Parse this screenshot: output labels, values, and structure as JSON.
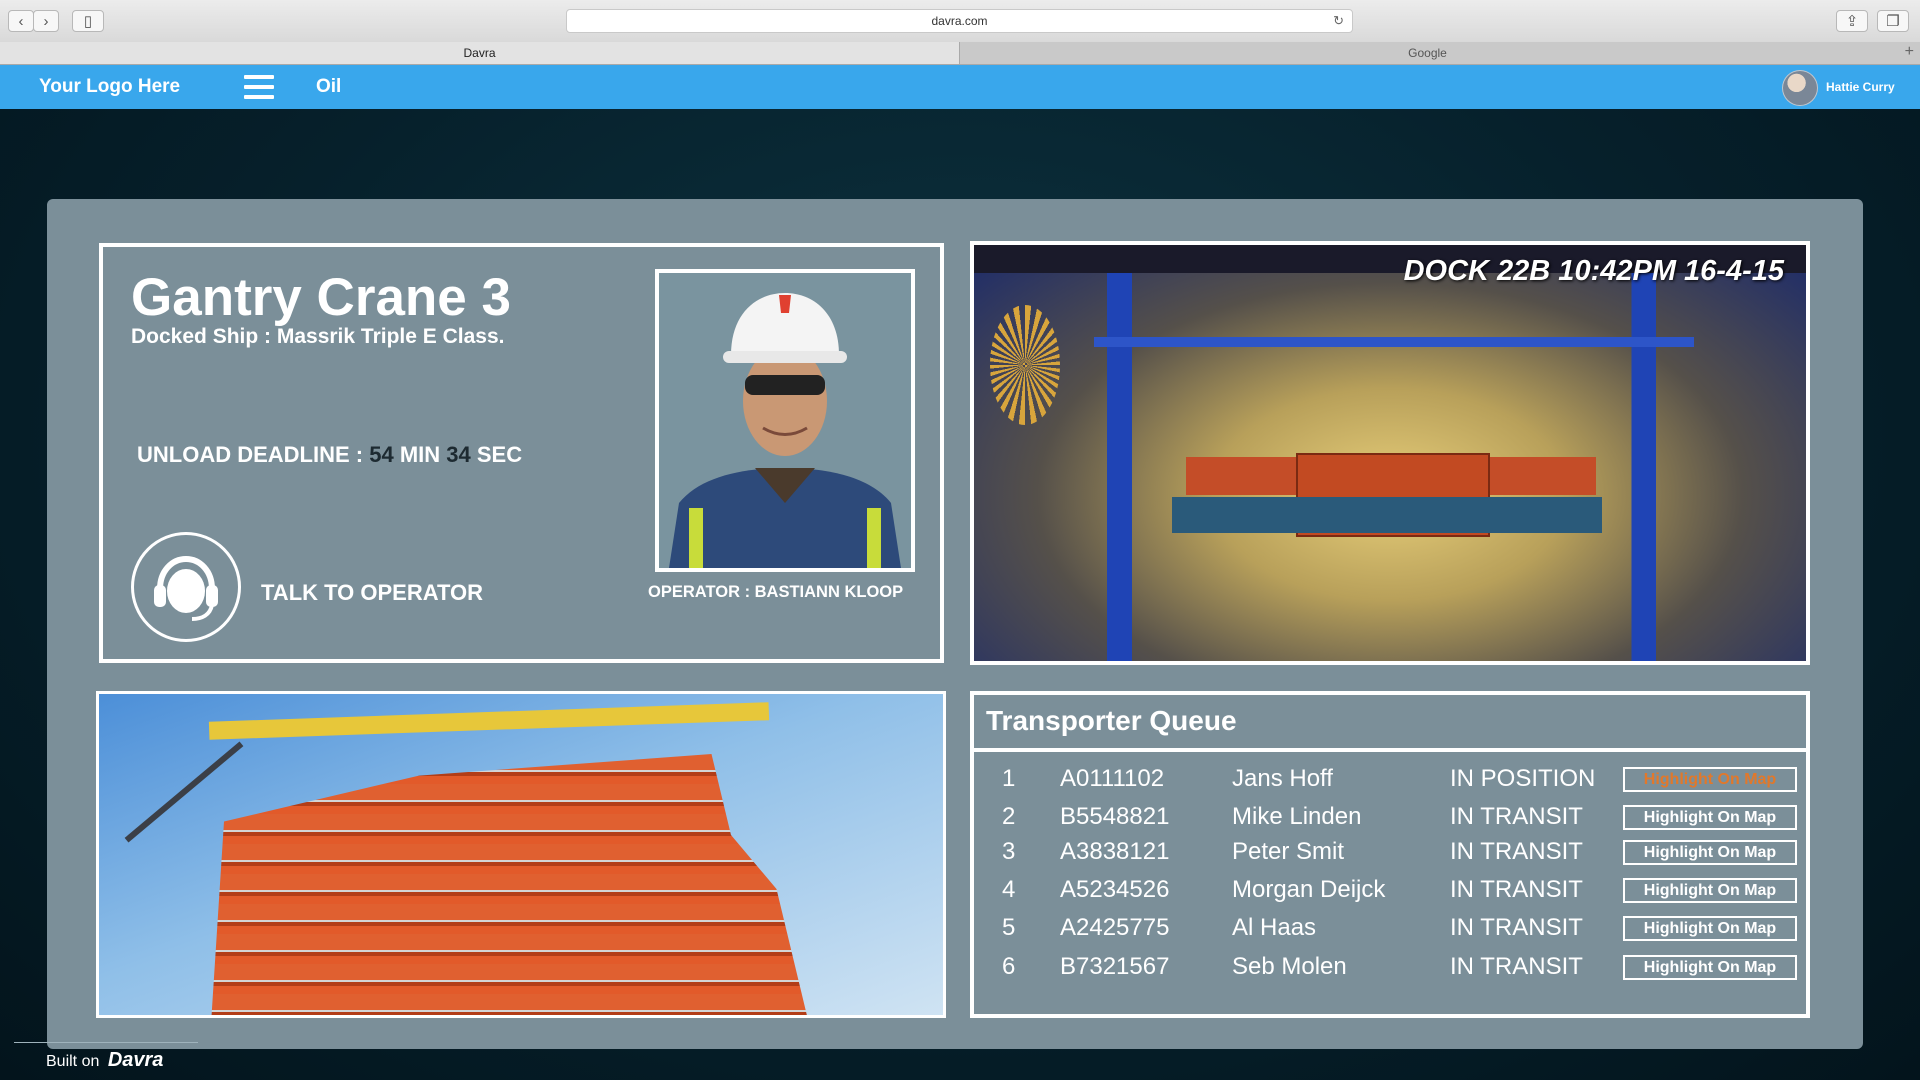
{
  "browser": {
    "address": "davra.com",
    "tabs": [
      {
        "label": "Davra",
        "active": true
      },
      {
        "label": "Google",
        "active": false
      }
    ]
  },
  "app_bar": {
    "logo": "Your Logo Here",
    "section": "Oil",
    "user_name": "Hattie Curry",
    "color": "#39a7ec"
  },
  "crane": {
    "title": "Gantry Crane 3",
    "docked_ship": "Docked Ship :  Massrik Triple E Class.",
    "deadline_label": "UNLOAD DEADLINE : ",
    "deadline_min": "54",
    "min_label": " MIN ",
    "deadline_sec": "34",
    "sec_label": " SEC",
    "talk_label": "TALK TO OPERATOR",
    "operator_caption": "OPERATOR : BASTIANN KLOOP"
  },
  "camera": {
    "overlay": "DOCK 22B  10:42PM  16-4-15"
  },
  "queue": {
    "title": "Transporter Queue",
    "rows": [
      {
        "index": "1",
        "id": "A0111102",
        "name": "Jans Hoff",
        "status": "IN POSITION",
        "button": "Highlight On Map",
        "highlighted": true
      },
      {
        "index": "2",
        "id": "B5548821",
        "name": "Mike Linden",
        "status": "IN TRANSIT",
        "button": "Highlight On Map",
        "highlighted": false
      },
      {
        "index": "3",
        "id": "A3838121",
        "name": "Peter Smit",
        "status": "IN TRANSIT",
        "button": "Highlight On Map",
        "highlighted": false
      },
      {
        "index": "4",
        "id": "A5234526",
        "name": "Morgan Deijck",
        "status": "IN TRANSIT",
        "button": "Highlight On Map",
        "highlighted": false
      },
      {
        "index": "5",
        "id": "A2425775",
        "name": "Al Haas",
        "status": "IN TRANSIT",
        "button": "Highlight On Map",
        "highlighted": false
      },
      {
        "index": "6",
        "id": "B7321567",
        "name": "Seb Molen",
        "status": "IN TRANSIT",
        "button": "Highlight On Map",
        "highlighted": false
      }
    ]
  },
  "footer": {
    "prefix": "Built on ",
    "brand": "Davra"
  }
}
